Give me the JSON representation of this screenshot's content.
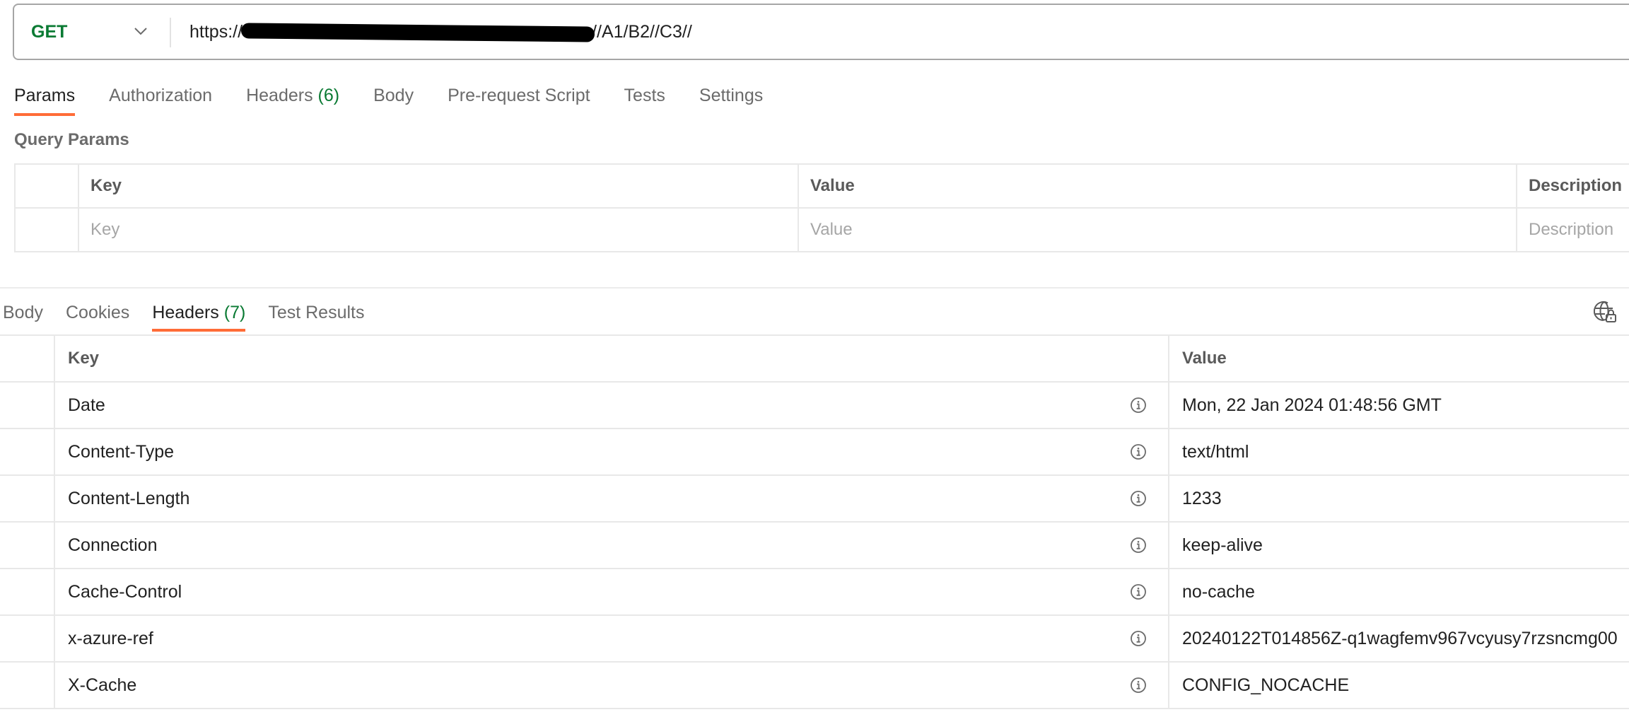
{
  "request": {
    "method": "GET",
    "url_prefix": "https://",
    "url_suffix": "//A1/B2//C3//",
    "url_redacted": true
  },
  "request_tabs": [
    {
      "label": "Params",
      "count": "",
      "active": true
    },
    {
      "label": "Authorization",
      "count": "",
      "active": false
    },
    {
      "label": "Headers",
      "count": "(6)",
      "active": false
    },
    {
      "label": "Body",
      "count": "",
      "active": false
    },
    {
      "label": "Pre-request Script",
      "count": "",
      "active": false
    },
    {
      "label": "Tests",
      "count": "",
      "active": false
    },
    {
      "label": "Settings",
      "count": "",
      "active": false
    }
  ],
  "query_params": {
    "title": "Query Params",
    "columns": [
      "Key",
      "Value",
      "Description"
    ],
    "placeholders": {
      "key": "Key",
      "value": "Value",
      "description": "Description"
    }
  },
  "response_tabs": [
    {
      "label": "Body",
      "count": "",
      "active": false
    },
    {
      "label": "Cookies",
      "count": "",
      "active": false
    },
    {
      "label": "Headers",
      "count": "(7)",
      "active": true
    },
    {
      "label": "Test Results",
      "count": "",
      "active": false
    }
  ],
  "response_headers": {
    "columns": [
      "Key",
      "Value"
    ],
    "rows": [
      {
        "key": "Date",
        "value": "Mon, 22 Jan 2024 01:48:56 GMT"
      },
      {
        "key": "Content-Type",
        "value": "text/html"
      },
      {
        "key": "Content-Length",
        "value": "1233"
      },
      {
        "key": "Connection",
        "value": "keep-alive"
      },
      {
        "key": "Cache-Control",
        "value": "no-cache"
      },
      {
        "key": "x-azure-ref",
        "value": "20240122T014856Z-q1wagfemv967vcyusy7rzsncmg00"
      },
      {
        "key": "X-Cache",
        "value": "CONFIG_NOCACHE"
      }
    ]
  },
  "icons": {
    "method_dropdown": "chevron-down-icon",
    "network_info": "globe-lock-icon",
    "header_info": "info-icon"
  },
  "colors": {
    "accent_underline": "#ff6c37",
    "method_green": "#0a7a33",
    "count_green": "#0a7a33"
  }
}
